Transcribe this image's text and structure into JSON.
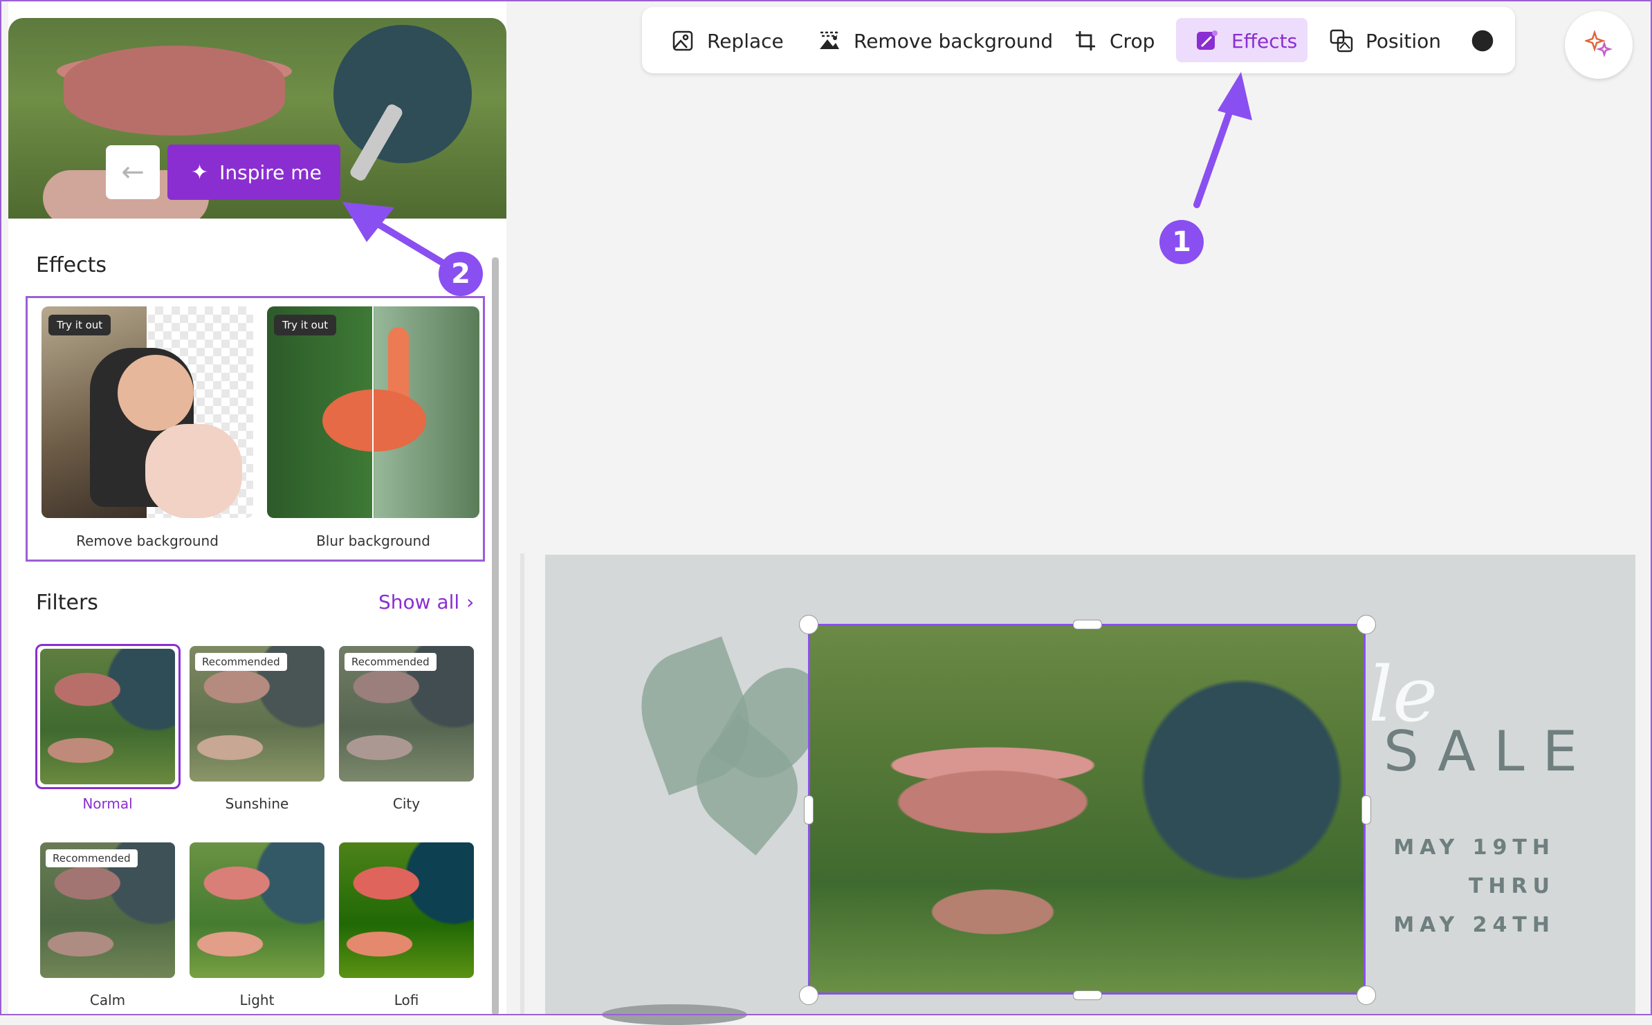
{
  "toolbar": {
    "items": [
      {
        "label": "Replace",
        "icon": "image-replace-icon"
      },
      {
        "label": "Remove background",
        "icon": "remove-background-icon"
      },
      {
        "label": "Crop",
        "icon": "crop-icon"
      },
      {
        "label": "Effects",
        "icon": "effects-icon",
        "active": true
      },
      {
        "label": "Position",
        "icon": "position-icon"
      }
    ],
    "accent": "#8a2ed1",
    "active_bg": "#eddcfb"
  },
  "panel": {
    "inspire_label": "Inspire me",
    "effects_title": "Effects",
    "effects": [
      {
        "badge": "Try it out",
        "caption": "Remove background"
      },
      {
        "badge": "Try it out",
        "caption": "Blur background"
      }
    ],
    "filters_title": "Filters",
    "show_all_label": "Show all",
    "filters": [
      {
        "caption": "Normal",
        "badge": "",
        "selected": true
      },
      {
        "caption": "Sunshine",
        "badge": "Recommended"
      },
      {
        "caption": "City",
        "badge": "Recommended"
      },
      {
        "caption": "Calm",
        "badge": "Recommended"
      },
      {
        "caption": "Light",
        "badge": ""
      },
      {
        "caption": "Lofi",
        "badge": ""
      }
    ]
  },
  "annotations": {
    "one": "1",
    "two": "2",
    "color": "#8a4ff0"
  },
  "design": {
    "script_text": "le",
    "sale_text": "SALE",
    "date_lines": [
      "MAY 19TH",
      "THRU",
      "MAY 24TH"
    ]
  }
}
